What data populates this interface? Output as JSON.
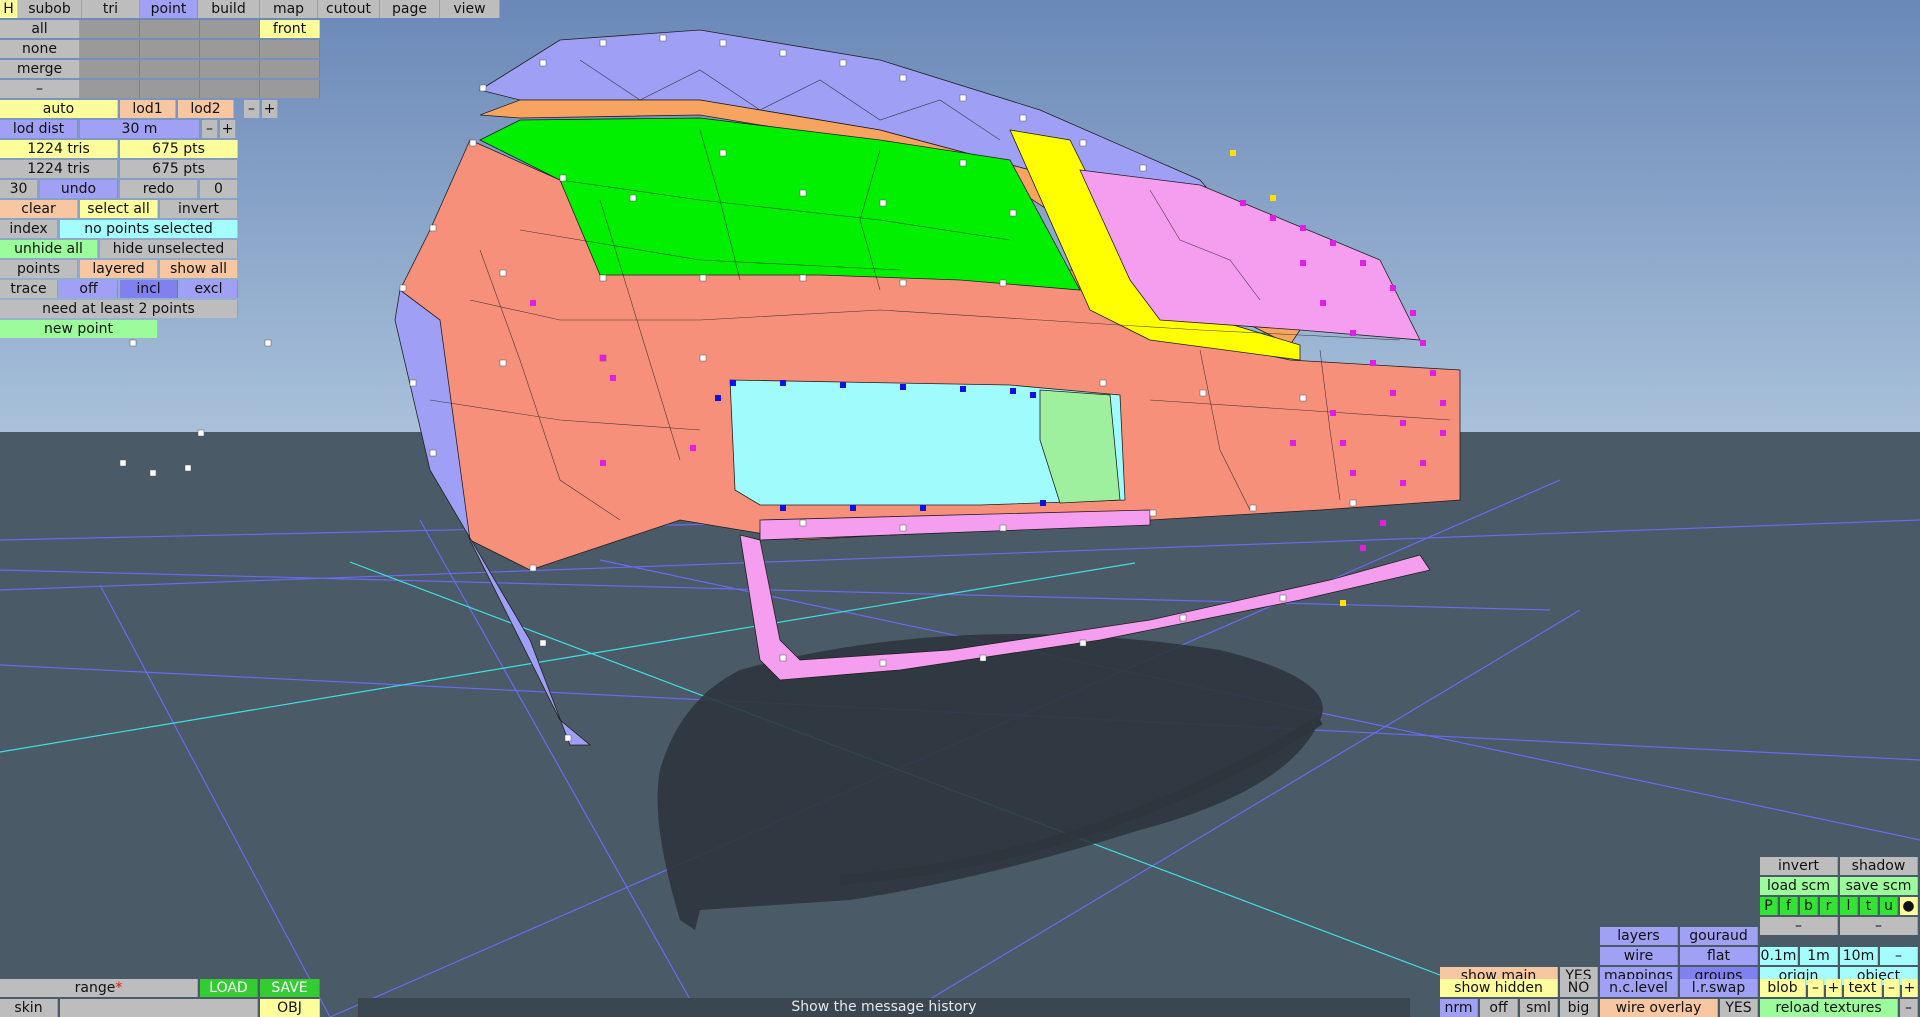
{
  "toolbar": {
    "help_label": "H",
    "tabs": [
      "subob",
      "tri",
      "point",
      "build",
      "map",
      "cutout",
      "page",
      "view"
    ],
    "active_tab": "point"
  },
  "select": {
    "all": "all",
    "none": "none",
    "merge": "merge",
    "minus": "–",
    "front": "front"
  },
  "lod": {
    "auto": "auto",
    "lod1": "lod1",
    "lod2": "lod2",
    "minus": "–",
    "plus": "+",
    "dist_label": "lod dist",
    "dist_value": "30 m",
    "dist_minus": "–",
    "dist_plus": "+"
  },
  "stats": {
    "row1_tris": "1224 tris",
    "row1_pts": "675 pts",
    "row2_tris": "1224 tris",
    "row2_pts": "675 pts"
  },
  "history": {
    "count": "30",
    "undo": "undo",
    "redo": "redo",
    "redo_count": "0"
  },
  "selection": {
    "clear": "clear",
    "select_all": "select all",
    "invert": "invert",
    "index": "index",
    "status": "no points selected",
    "unhide_all": "unhide all",
    "hide_unselected": "hide unselected",
    "points": "points",
    "layered": "layered",
    "show_all": "show all",
    "trace": "trace",
    "off": "off",
    "incl": "incl",
    "excl": "excl",
    "hint": "need at least 2 points",
    "new_point": "new point"
  },
  "bottom_left": {
    "range_label": "range",
    "range_star": "*",
    "load": "LOAD",
    "save": "SAVE",
    "skin": "skin",
    "obj": "OBJ"
  },
  "message_bar": "Show the message history",
  "bottom_right": {
    "invert": "invert",
    "shadow": "shadow",
    "load_scm": "load scm",
    "save_scm": "save scm",
    "letters": [
      "P",
      "f",
      "b",
      "r",
      "l",
      "t",
      "u"
    ],
    "dot": "●",
    "dash1": "–",
    "dash2": "–",
    "layers": "layers",
    "gouraud": "gouraud",
    "wire": "wire",
    "flat": "flat",
    "dist_01": "0.1m",
    "dist_1": "1m",
    "dist_10": "10m",
    "dist_minus": "–",
    "show_main": "show main",
    "show_main_val": "YES",
    "mappings": "mappings",
    "groups": "groups",
    "origin": "origin",
    "object": "object",
    "show_hidden": "show hidden",
    "show_hidden_val": "NO",
    "nc_level": "n.c.level",
    "lr_swap": "l.r.swap",
    "blob": "blob",
    "blob_minus": "–",
    "blob_plus": "+",
    "text": "text",
    "text_minus": "–",
    "text_plus": "+",
    "nrm": "nrm",
    "off": "off",
    "sml": "sml",
    "big": "big",
    "wire_overlay": "wire overlay",
    "wire_overlay_val": "YES",
    "reload_textures": "reload textures",
    "reload_minus": "–"
  },
  "colors": {
    "sky": "#6f8fbd",
    "ground": "#4a5a66",
    "green_face": "#00f000",
    "salmon_face": "#f7907a",
    "lavender_face": "#9f9ff6",
    "cyan_face": "#a0fcfc",
    "pink_face": "#f59ef0",
    "yellow_face": "#ffff00",
    "magenta_point": "#e020e0"
  }
}
